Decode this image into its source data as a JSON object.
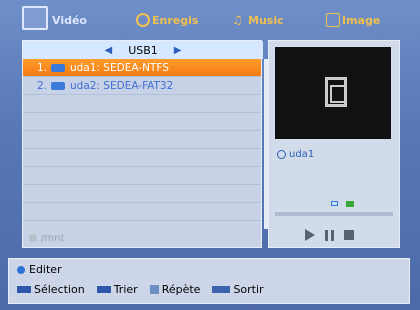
{
  "tabs": [
    {
      "label": "Vidéo",
      "active": true
    },
    {
      "label": "Enregis",
      "active": false
    },
    {
      "label": "Music",
      "active": false
    },
    {
      "label": "Image",
      "active": false
    }
  ],
  "source": {
    "label": "USB1"
  },
  "files": [
    {
      "index": "1.",
      "label": "uda1: SEDEA-NTFS",
      "selected": true
    },
    {
      "index": "2.",
      "label": "uda2: SEDEA-FAT32",
      "selected": false
    }
  ],
  "path": "/mnt",
  "preview": {
    "name": "uda1"
  },
  "help": {
    "edit": "Editer",
    "selection": "Sélection",
    "trier": "Trier",
    "repete": "Répète",
    "sortir": "Sortir"
  },
  "colors": {
    "accent": "#f57c14",
    "tab_inactive": "#f0c050",
    "link": "#3f6ed4"
  }
}
